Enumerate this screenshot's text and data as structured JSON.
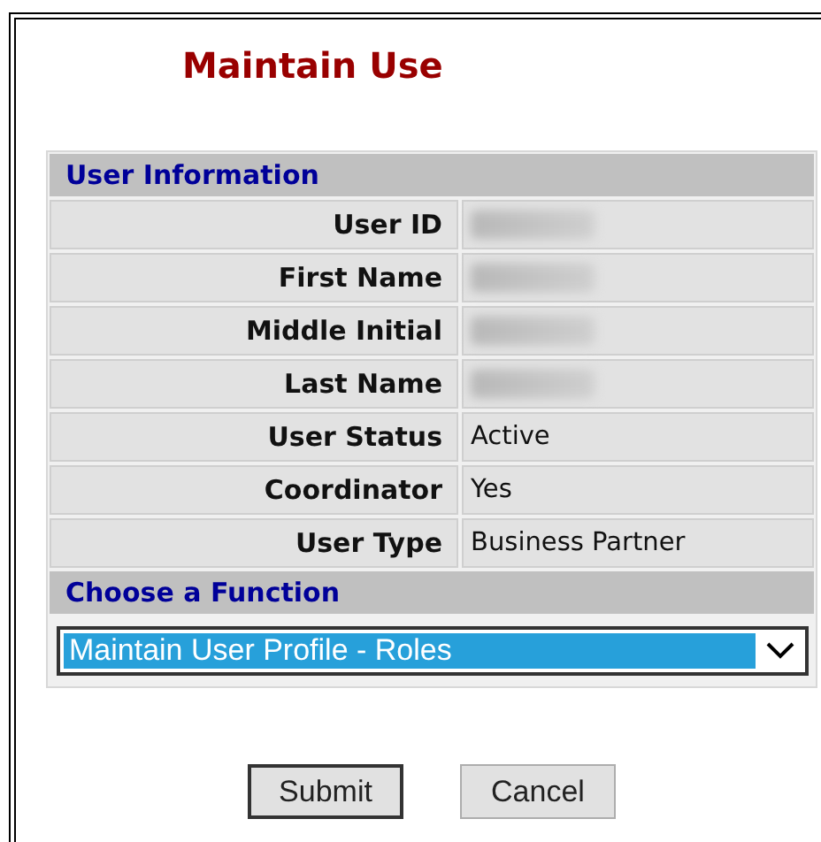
{
  "title": "Maintain Use",
  "user_information": {
    "heading": "User Information",
    "rows": [
      {
        "label": "User ID",
        "redacted": true
      },
      {
        "label": "First Name",
        "redacted": true
      },
      {
        "label": "Middle Initial",
        "redacted": true
      },
      {
        "label": "Last Name",
        "redacted": true
      },
      {
        "label": "User Status",
        "redacted": false,
        "value": "Active"
      },
      {
        "label": "Coordinator",
        "redacted": false,
        "value": "Yes"
      },
      {
        "label": "User Type",
        "redacted": false,
        "value": "Business Partner"
      }
    ]
  },
  "choose_function": {
    "heading": "Choose a Function",
    "value": "Maintain User Profile - Roles"
  },
  "buttons": [
    {
      "label": "Submit",
      "focused": true
    },
    {
      "label": "Cancel",
      "focused": false
    }
  ]
}
